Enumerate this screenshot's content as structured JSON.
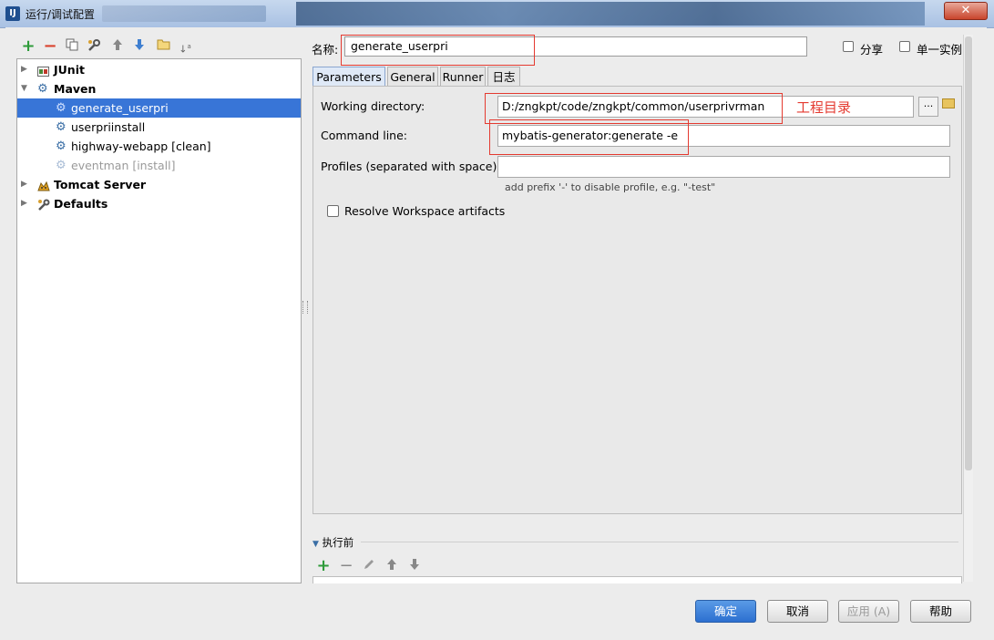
{
  "window": {
    "title": "运行/调试配置",
    "app_icon": "IJ",
    "close_glyph": "✕"
  },
  "left_toolbar": {
    "icons": [
      "add-icon",
      "remove-icon",
      "copy-icon",
      "wrench-icon",
      "arrow-up-icon",
      "arrow-down-icon",
      "folder-icon",
      "sort-icon"
    ]
  },
  "tree": {
    "items": [
      {
        "label": "JUnit",
        "icon": "junit-icon",
        "expandable": true,
        "expanded": false,
        "bold": true
      },
      {
        "label": "Maven",
        "icon": "gear-icon",
        "expandable": true,
        "expanded": true,
        "bold": true
      },
      {
        "label": "generate_userpri",
        "icon": "gear-icon",
        "selected": true
      },
      {
        "label": "userpriinstall",
        "icon": "gear-icon"
      },
      {
        "label": "highway-webapp [clean]",
        "icon": "gear-icon"
      },
      {
        "label": "eventman [install]",
        "icon": "gear-icon",
        "disabled": true
      },
      {
        "label": "Tomcat Server",
        "icon": "tomcat-icon",
        "expandable": true,
        "expanded": false,
        "bold": true
      },
      {
        "label": "Defaults",
        "icon": "wrench-icon",
        "expandable": true,
        "expanded": false,
        "bold": true
      }
    ]
  },
  "name_row": {
    "label": "名称:",
    "value": "generate_userpri",
    "share_label": "分享",
    "single_instance_label": "单一实例"
  },
  "tabs": [
    {
      "label": "Parameters",
      "active": true
    },
    {
      "label": "General"
    },
    {
      "label": "Runner"
    },
    {
      "label": "日志"
    }
  ],
  "parameters": {
    "working_dir_label": "Working directory:",
    "working_dir_value": "D:/zngkpt/code/zngkpt/common/userprivrman",
    "browse_label": "...",
    "annotation": "工程目录",
    "command_line_label": "Command line:",
    "command_line_value": "mybatis-generator:generate -e",
    "profiles_label": "Profiles (separated with space):",
    "profiles_value": "",
    "profiles_hint": "add prefix '-' to disable profile, e.g. \"-test\"",
    "resolve_label": "Resolve Workspace artifacts",
    "resolve_checked": false
  },
  "before_launch": {
    "title": "执行前",
    "icons": [
      "add-icon",
      "remove-icon",
      "edit-icon",
      "arrow-up-icon",
      "arrow-down-icon"
    ]
  },
  "buttons": {
    "ok": "确定",
    "cancel": "取消",
    "apply": "应用 (A)",
    "help": "帮助"
  },
  "colors": {
    "selection": "#3875d7",
    "annotation_red": "#e43a30",
    "primary_button": "#2c6fd0",
    "add_green": "#2e9b3a",
    "remove_red": "#d9412c"
  }
}
